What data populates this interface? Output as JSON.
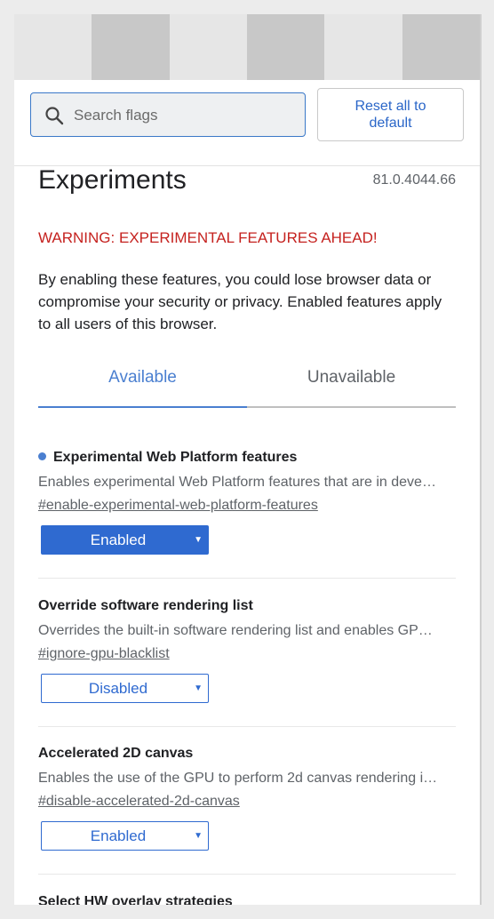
{
  "search": {
    "placeholder": "Search flags"
  },
  "reset_button": "Reset all to default",
  "header": {
    "title": "Experiments",
    "version": "81.0.4044.66"
  },
  "warning": "WARNING: EXPERIMENTAL FEATURES AHEAD!",
  "intro": "By enabling these features, you could lose browser data or compromise your security or privacy. Enabled features apply to all users of this browser.",
  "tabs": [
    {
      "label": "Available",
      "active": true
    },
    {
      "label": "Unavailable",
      "active": false
    }
  ],
  "features": [
    {
      "title": "Experimental Web Platform features",
      "description": "Enables experimental Web Platform features that are in deve…",
      "link": "#enable-experimental-web-platform-features",
      "value": "Enabled",
      "modified": true
    },
    {
      "title": "Override software rendering list",
      "description": "Overrides the built-in software rendering list and enables GP…",
      "link": "#ignore-gpu-blacklist",
      "value": "Disabled",
      "modified": false
    },
    {
      "title": "Accelerated 2D canvas",
      "description": "Enables the use of the GPU to perform 2d canvas rendering i…",
      "link": "#disable-accelerated-2d-canvas",
      "value": "Enabled",
      "modified": false
    },
    {
      "title": "Select HW overlay strategies"
    }
  ],
  "colors": {
    "accent": "#2f6ad0",
    "warning": "#c5221f",
    "tab_active": "#4a7fd0"
  },
  "icons": {
    "search": "search-icon",
    "dropdown": "triangle-down-icon",
    "modified": "blue-dot-icon"
  }
}
